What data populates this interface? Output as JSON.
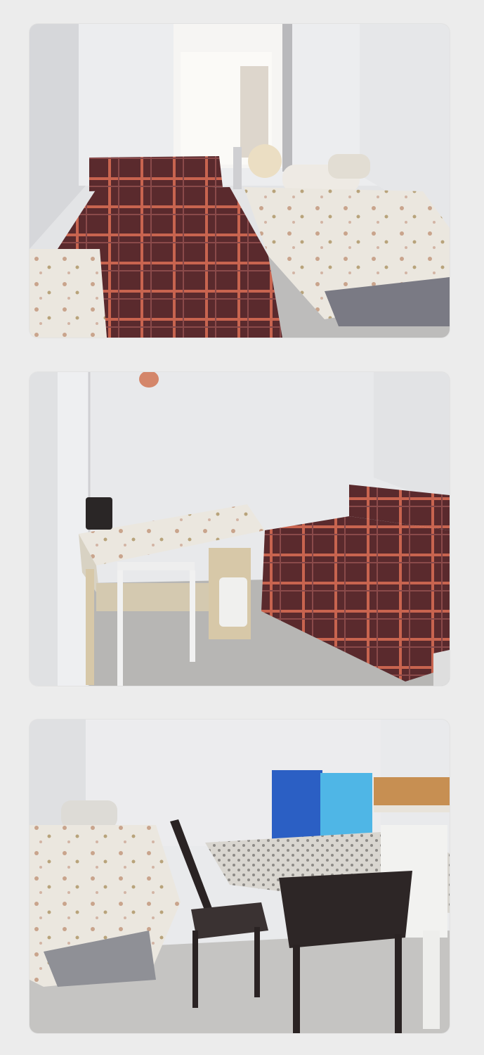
{
  "gallery": {
    "photos": [
      {
        "name": "bedroom-two-beds"
      },
      {
        "name": "bedroom-desk-and-bed"
      },
      {
        "name": "bedroom-desk-chairs-bed"
      }
    ]
  },
  "colors": {
    "page_background": "#ececec",
    "wall": "#e9e9ea",
    "plaid_bedding": "#5a2a2d",
    "plaid_stripe": "#d06a55",
    "floral_bedding": "#ece8e0",
    "chair": "#2a2323",
    "blue_poster": "#2b5fc4",
    "cyan_poster": "#4fb6e6",
    "wood": "#c78f52"
  }
}
